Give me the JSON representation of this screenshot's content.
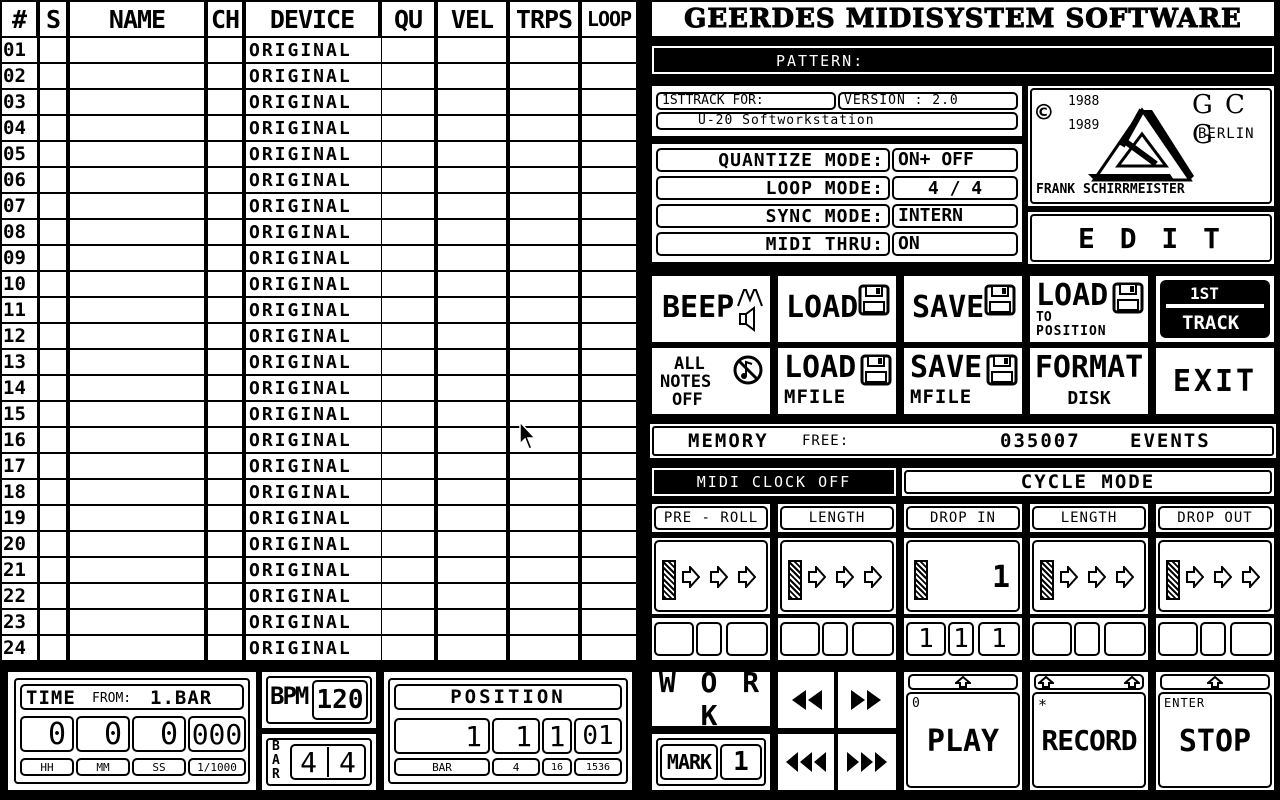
{
  "app": {
    "title": "GEERDES MIDISYSTEM SOFTWARE",
    "pattern_label": "PATTERN:"
  },
  "table": {
    "headers": [
      "#",
      "S",
      "NAME",
      "CH",
      "DEVICE",
      "QU",
      "VEL",
      "TRPS",
      "LOOP"
    ],
    "rows": [
      {
        "num": "01",
        "device": "ORIGINAL"
      },
      {
        "num": "02",
        "device": "ORIGINAL"
      },
      {
        "num": "03",
        "device": "ORIGINAL"
      },
      {
        "num": "04",
        "device": "ORIGINAL"
      },
      {
        "num": "05",
        "device": "ORIGINAL"
      },
      {
        "num": "06",
        "device": "ORIGINAL"
      },
      {
        "num": "07",
        "device": "ORIGINAL"
      },
      {
        "num": "08",
        "device": "ORIGINAL"
      },
      {
        "num": "09",
        "device": "ORIGINAL"
      },
      {
        "num": "10",
        "device": "ORIGINAL"
      },
      {
        "num": "11",
        "device": "ORIGINAL"
      },
      {
        "num": "12",
        "device": "ORIGINAL"
      },
      {
        "num": "13",
        "device": "ORIGINAL"
      },
      {
        "num": "14",
        "device": "ORIGINAL"
      },
      {
        "num": "15",
        "device": "ORIGINAL"
      },
      {
        "num": "16",
        "device": "ORIGINAL"
      },
      {
        "num": "17",
        "device": "ORIGINAL"
      },
      {
        "num": "18",
        "device": "ORIGINAL"
      },
      {
        "num": "19",
        "device": "ORIGINAL"
      },
      {
        "num": "20",
        "device": "ORIGINAL"
      },
      {
        "num": "21",
        "device": "ORIGINAL"
      },
      {
        "num": "22",
        "device": "ORIGINAL"
      },
      {
        "num": "23",
        "device": "ORIGINAL"
      },
      {
        "num": "24",
        "device": "ORIGINAL"
      }
    ]
  },
  "info": {
    "for_label": "1STTRACK  FOR:",
    "version": "VERSION : 2.0",
    "device": "U-20 Softworkstation"
  },
  "modes": [
    {
      "label": "QUANTIZE MODE:",
      "value": "ON+ OFF"
    },
    {
      "label": "LOOP MODE:",
      "value": "4 / 4"
    },
    {
      "label": "SYNC MODE:",
      "value": "INTERN"
    },
    {
      "label": "MIDI THRU:",
      "value": "ON"
    }
  ],
  "logo": {
    "copyright": "©",
    "year1": "1988",
    "year2": "1989",
    "brand": "G C G",
    "city": "BERLIN",
    "author": "FRANK SCHIRRMEISTER"
  },
  "edit_label": "E D I T",
  "buttons": {
    "beep": "BEEP",
    "load": "LOAD",
    "save": "SAVE",
    "load_to": "LOAD",
    "load_to_sub1": "TO",
    "load_to_sub2": "POSITION",
    "first_track_top": "1ST",
    "first_track_bottom": "TRACK",
    "all_notes_1": "ALL",
    "all_notes_2": "NOTES",
    "all_notes_3": "OFF",
    "load_mfile": "LOAD",
    "load_mfile_sub": "MFILE",
    "save_mfile": "SAVE",
    "save_mfile_sub": "MFILE",
    "format": "FORMAT",
    "format_sub": "DISK",
    "exit": "EXIT"
  },
  "memory": {
    "label": "MEMORY",
    "free_label": "FREE:",
    "value": "035007",
    "unit": "EVENTS"
  },
  "midi_clock": "MIDI CLOCK OFF",
  "cycle_mode": "CYCLE MODE",
  "cycle": {
    "headers": [
      "PRE - ROLL",
      "LENGTH",
      "DROP  IN",
      "LENGTH",
      "DROP  OUT"
    ],
    "drop_in_value": "1",
    "drop_in_digits": [
      "1",
      "1",
      "1"
    ]
  },
  "time": {
    "label": "TIME",
    "from_label": "FROM:",
    "from_value": "1.BAR",
    "values": [
      "0",
      "0",
      "0",
      "000"
    ],
    "units": [
      "HH",
      "MM",
      "SS",
      "1/1000"
    ]
  },
  "bpm": {
    "label": "BPM",
    "value": "120"
  },
  "bar": {
    "label_top": "B",
    "label_mid": "A",
    "label_bot": "R",
    "value1": "4",
    "value2": "4"
  },
  "position": {
    "label": "POSITION",
    "values": [
      "1",
      "1",
      "1",
      "01"
    ],
    "units": [
      "BAR",
      "4",
      "16",
      "1536"
    ]
  },
  "work_label": "W O R K",
  "mark": {
    "label": "MARK",
    "value": "1"
  },
  "transport": {
    "play_key": "0",
    "play": "PLAY",
    "record_key": "*",
    "record": "RECORD",
    "stop_key": "ENTER",
    "stop": "STOP"
  }
}
